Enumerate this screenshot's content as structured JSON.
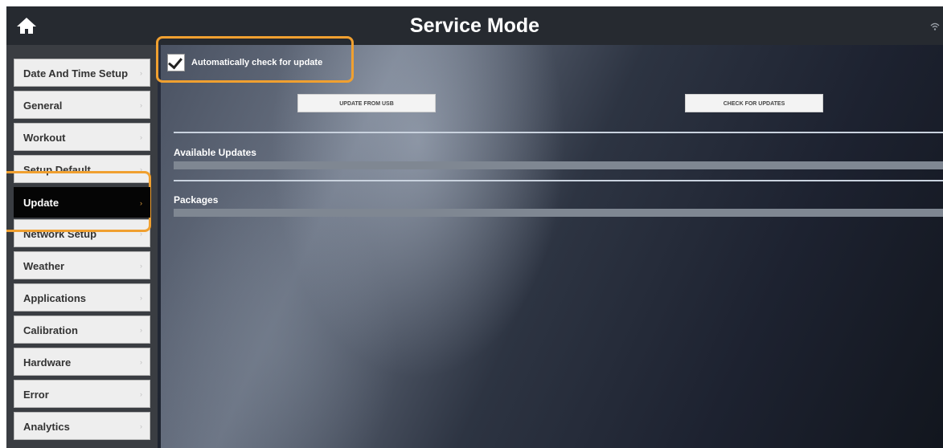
{
  "header": {
    "title": "Service Mode",
    "home_icon": "home-icon",
    "status_icon": "wifi-icon"
  },
  "sidebar": {
    "items": [
      {
        "label": "Date And Time Setup",
        "active": false
      },
      {
        "label": "General",
        "active": false
      },
      {
        "label": "Workout",
        "active": false
      },
      {
        "label": "Setup Default",
        "active": false
      },
      {
        "label": "Update",
        "active": true
      },
      {
        "label": "Network Setup",
        "active": false
      },
      {
        "label": "Weather",
        "active": false
      },
      {
        "label": "Applications",
        "active": false
      },
      {
        "label": "Calibration",
        "active": false
      },
      {
        "label": "Hardware",
        "active": false
      },
      {
        "label": "Error",
        "active": false
      },
      {
        "label": "Analytics",
        "active": false
      }
    ],
    "chevron": "›"
  },
  "update": {
    "auto_check_label": "Automatically check for update",
    "auto_check_checked": true,
    "update_from_usb_label": "UPDATE FROM USB",
    "check_for_updates_label": "CHECK FOR UPDATES",
    "available_updates_label": "Available Updates",
    "packages_label": "Packages"
  },
  "colors": {
    "highlight": "#f0a030",
    "active_item": "#050505",
    "title_bar": "#262a30"
  }
}
